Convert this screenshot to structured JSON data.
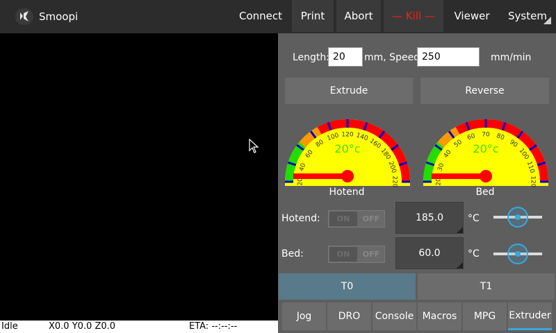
{
  "header": {
    "app_title": "Smoopi",
    "menu": [
      "Connect",
      "Print",
      "Abort",
      "Kill",
      "Viewer",
      "System"
    ]
  },
  "status_bar": {
    "state": "Idle",
    "position": "X0.0 Y0.0 Z0.0",
    "eta": "ETA: --:--:--"
  },
  "extruder": {
    "length_label": "Length:",
    "length_value": "20",
    "speed_label": "mm, Speed:",
    "speed_value": "250",
    "units": "mm/min",
    "extrude_label": "Extrude",
    "reverse_label": "Reverse"
  },
  "gauges": [
    {
      "name": "Hotend",
      "reading": "20°c",
      "value": 20,
      "ticks": [
        "20",
        "40",
        "60",
        "80",
        "100",
        "120",
        "140",
        "160",
        "180",
        "200",
        "220"
      ]
    },
    {
      "name": "Bed",
      "reading": "20°c",
      "value": 20,
      "ticks": [
        "20",
        "30",
        "40",
        "50",
        "60",
        "70",
        "80",
        "90",
        "100",
        "110",
        "120"
      ]
    }
  ],
  "heaters": [
    {
      "label": "Hotend:",
      "on_label": "ON",
      "off_label": "OFF",
      "setpoint": "185.0",
      "unit": "°C",
      "slider_value": 0.5
    },
    {
      "label": "Bed:",
      "on_label": "ON",
      "off_label": "OFF",
      "setpoint": "60.0",
      "unit": "°C",
      "slider_value": 0.5
    }
  ],
  "tools": [
    {
      "label": "T0",
      "selected": true
    },
    {
      "label": "T1",
      "selected": false
    }
  ],
  "tabs": [
    {
      "label": "Jog"
    },
    {
      "label": "DRO"
    },
    {
      "label": "Console"
    },
    {
      "label": "Macros"
    },
    {
      "label": "MPG"
    },
    {
      "label": "Extruder",
      "active": true
    }
  ],
  "colors": {
    "accent": "#39a8e0",
    "kill": "#ff1a1a",
    "gauge_face": "#ffff00",
    "gauge_needle": "#ff0000",
    "gauge_reading": "#44dd00",
    "tool_selected": "#587a8a"
  }
}
